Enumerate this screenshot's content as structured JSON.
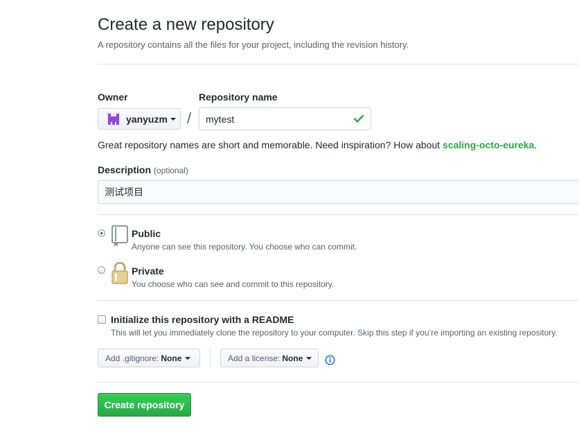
{
  "header": {
    "title": "Create a new repository",
    "subtitle": "A repository contains all the files for your project, including the revision history."
  },
  "owner": {
    "label": "Owner",
    "name": "yanyuzm",
    "avatar_color": "#8a4cd6"
  },
  "separator": "/",
  "repo_name": {
    "label": "Repository name",
    "value": "mytest",
    "valid_color": "#28a745"
  },
  "hint": {
    "prefix": "Great repository names are short and memorable. Need inspiration? How about ",
    "suggestion": "scaling-octo-eureka",
    "suffix": "."
  },
  "description": {
    "label": "Description",
    "optional": "(optional)",
    "value": "测试项目"
  },
  "visibility": {
    "public": {
      "title": "Public",
      "desc": "Anyone can see this repository. You choose who can commit.",
      "checked": true
    },
    "private": {
      "title": "Private",
      "desc": "You choose who can see and commit to this repository.",
      "checked": false
    }
  },
  "readme": {
    "title": "Initialize this repository with a README",
    "desc": "This will let you immediately clone the repository to your computer. Skip this step if you’re importing an existing repository.",
    "checked": false
  },
  "gitignore": {
    "label": "Add .gitignore:",
    "value": "None"
  },
  "license": {
    "label": "Add a license:",
    "value": "None"
  },
  "submit": {
    "label": "Create repository",
    "color": "#28a745"
  },
  "icons": {
    "public": "repo-book-icon",
    "private": "lock-icon",
    "valid": "check-icon",
    "info": "info-icon"
  }
}
